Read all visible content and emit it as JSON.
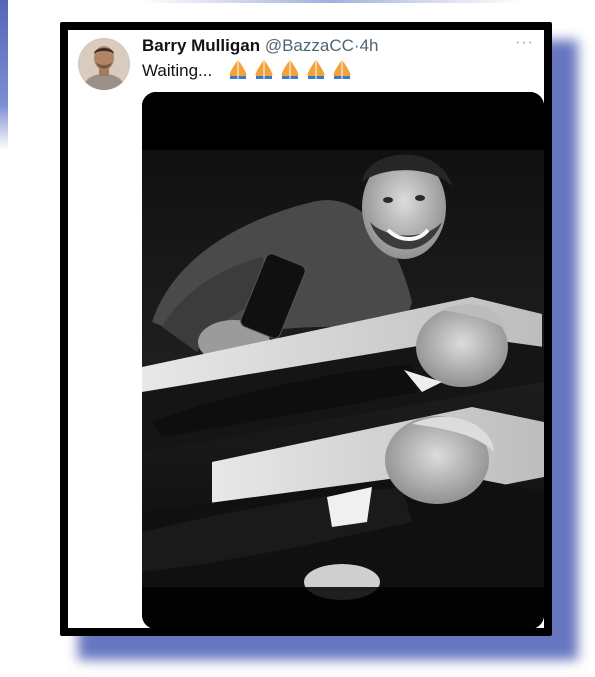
{
  "tweet": {
    "author_name": "Barry Mulligan",
    "handle": "@BazzaCC",
    "separator": "·",
    "time": "4h",
    "text": "Waiting...",
    "emoji_count": 5,
    "emoji_name": "folded-hands-icon",
    "more_label": "···"
  },
  "colors": {
    "frame": "#000000",
    "shadow": "#4c5fb4",
    "emoji": "#f2a23b",
    "handle": "#536471"
  }
}
